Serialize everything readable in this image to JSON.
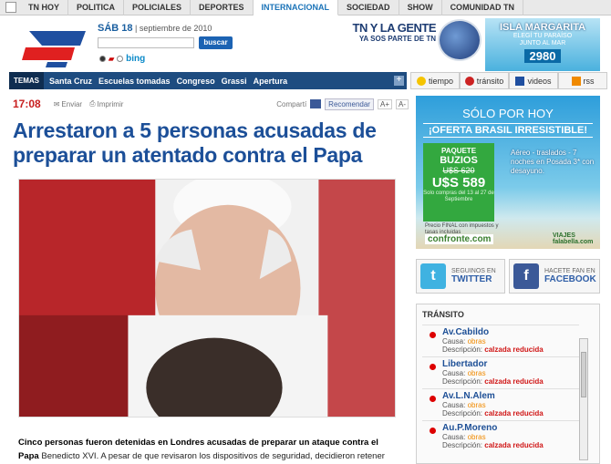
{
  "topnav": {
    "items": [
      "TN HOY",
      "POLITICA",
      "POLICIALES",
      "DEPORTES",
      "INTERNACIONAL",
      "SOCIEDAD",
      "SHOW",
      "COMUNIDAD TN"
    ],
    "active": "INTERNACIONAL"
  },
  "header": {
    "date_day": "SÁB 18",
    "date_rest": "septiembre de 2010",
    "search_button": "buscar",
    "search_engine": "bing",
    "promo_tn": {
      "line1": "TN Y LA GENTE",
      "line2": "YA SOS PARTE DE TN"
    },
    "promo_isla": {
      "title": "ISLA MARGARITA",
      "line1": "ELEGÍ TU PARAÍSO",
      "line2": "JUNTO AL MAR",
      "price": "2980"
    }
  },
  "topics": {
    "label": "TEMAS",
    "items": [
      "Santa Cruz",
      "Escuelas tomadas",
      "Congreso",
      "Grassi",
      "Apertura"
    ],
    "plus": "+"
  },
  "right_tabs": [
    "tiempo",
    "tránsito",
    "videos",
    "rss"
  ],
  "article": {
    "time": "17:08",
    "send": "Enviar",
    "print": "Imprimir",
    "share": "Compartí",
    "recommend": "Recomendar",
    "font_up": "A+",
    "font_down": "A-",
    "headline": "Arrestaron a 5 personas acusadas de preparar un atentado contra el Papa",
    "lede_bold": "Cinco personas fueron detenidas en Londres acusadas de preparar un ataque contra el Papa",
    "lede_rest": " Benedicto XVI.  A pesar de que revisaron los dispositivos de seguridad, decidieron retener"
  },
  "ad": {
    "line1": "SÓLO POR HOY",
    "line2": "¡OFERTA BRASIL IRRESISTIBLE!",
    "pkg": "PAQUETE",
    "dest": "BUZIOS",
    "old": "U$S 620",
    "new": "U$S 589",
    "note": "Solo compras del 13 al 27 de Septiembre",
    "desc": "Aéreo - traslados - 7 noches en Posada 3* con desayuno.",
    "fine": "Precio FINAL con impuestos y tasas incluidas",
    "brand1": "confronte.com",
    "brand2": "VIAJES falabella.com"
  },
  "social": {
    "twitter_top": "SEGUINOS EN",
    "twitter": "TWITTER",
    "facebook_top": "HACETE FAN EN",
    "facebook": "FACEBOOK"
  },
  "transit": {
    "title": "TRÁNSITO",
    "rows": [
      {
        "name": "Av.Cabildo",
        "causa_label": "Causa:",
        "causa": "obras",
        "desc_label": "Descripción:",
        "desc": "calzada reducida"
      },
      {
        "name": "Libertador",
        "causa_label": "Causa:",
        "causa": "obras",
        "desc_label": "Descripción:",
        "desc": "calzada reducida"
      },
      {
        "name": "Av.L.N.Alem",
        "causa_label": "Causa:",
        "causa": "obras",
        "desc_label": "Descripción:",
        "desc": "calzada reducida"
      },
      {
        "name": "Au.P.Moreno",
        "causa_label": "Causa:",
        "causa": "obras",
        "desc_label": "Descripción:",
        "desc": "calzada reducida"
      }
    ]
  }
}
